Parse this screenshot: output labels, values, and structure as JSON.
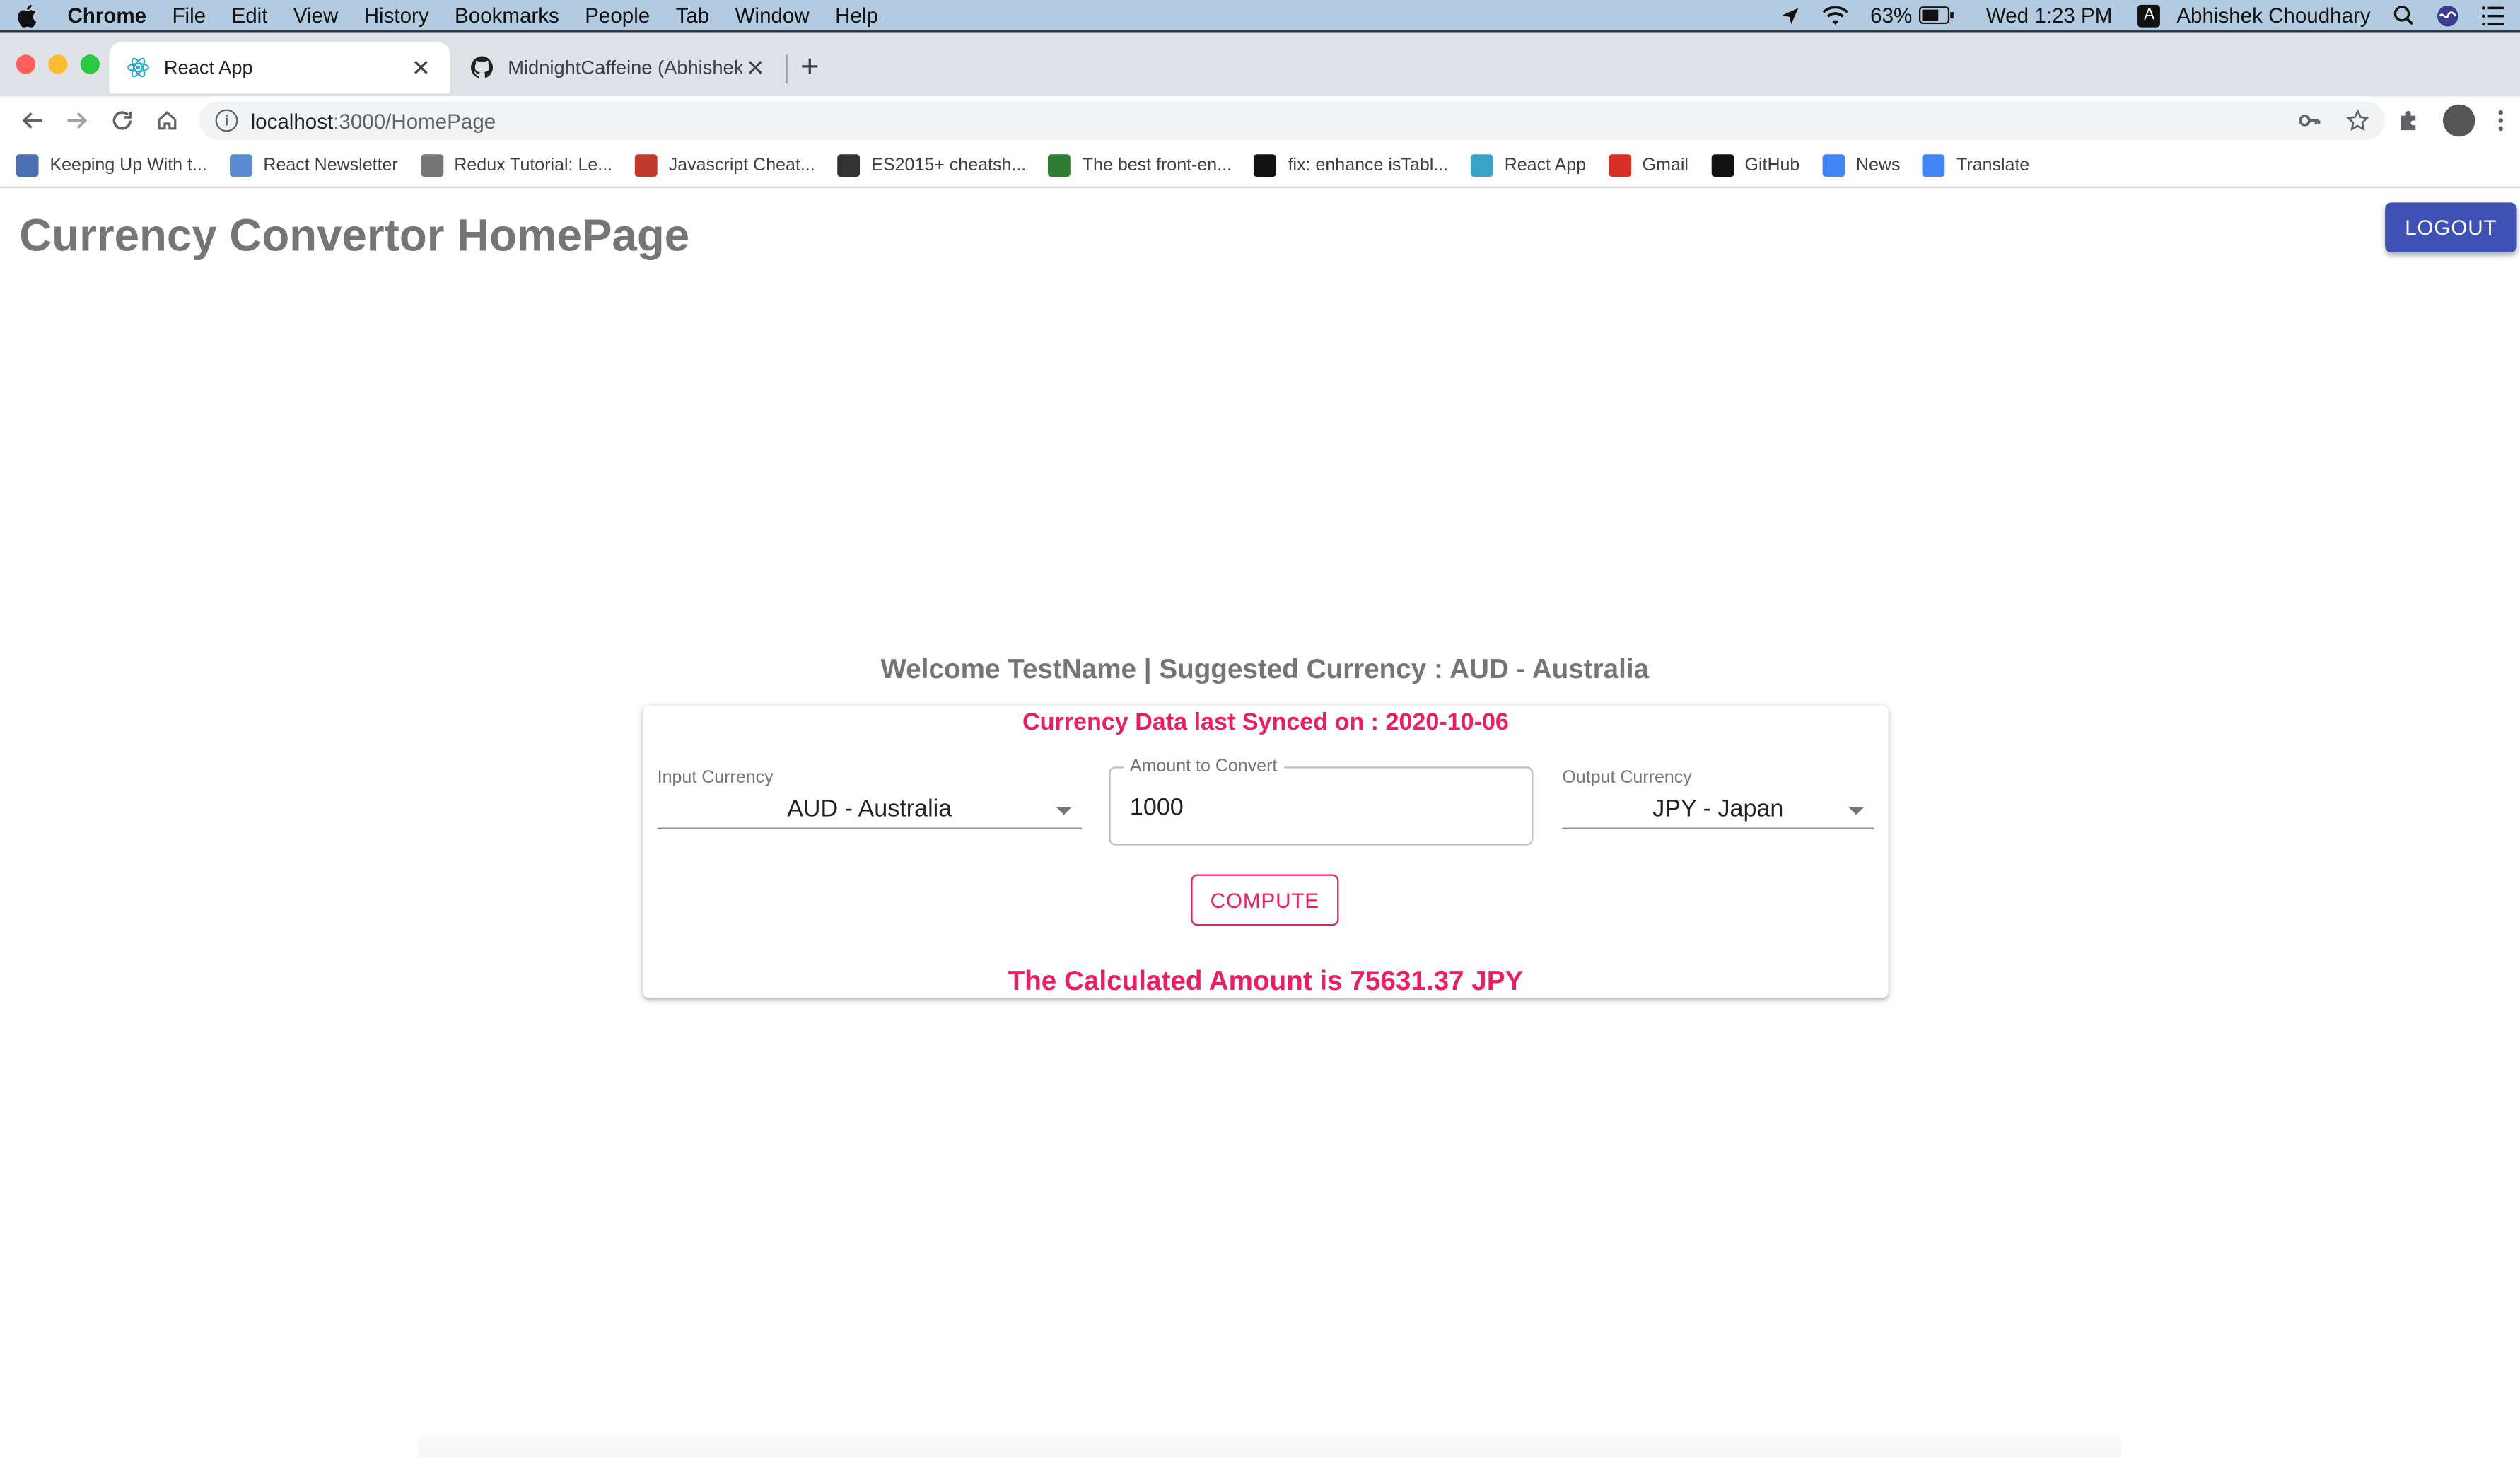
{
  "menubar": {
    "app": "Chrome",
    "menus": [
      "File",
      "Edit",
      "View",
      "History",
      "Bookmarks",
      "People",
      "Tab",
      "Window",
      "Help"
    ],
    "battery": "63%",
    "clock": "Wed 1:23 PM",
    "user": "Abhishek Choudhary",
    "input_badge": "A"
  },
  "tabs": [
    {
      "title": "React App",
      "close": "✕"
    },
    {
      "title": "MidnightCaffeine (Abhishek Ch",
      "close": "✕"
    }
  ],
  "new_tab": "+",
  "omnibox": {
    "host": "localhost",
    "path": ":3000/HomePage"
  },
  "bookmarks": [
    {
      "label": "Keeping Up With t...",
      "icon": "dc-icon",
      "color": "#4a6fb5"
    },
    {
      "label": "React Newsletter",
      "icon": "react-newsletter-icon",
      "color": "#5b8bd0"
    },
    {
      "label": "Redux Tutorial: Le...",
      "icon": "glasses-icon",
      "color": "#777777"
    },
    {
      "label": "Javascript Cheat...",
      "icon": "books-icon",
      "color": "#c0392b"
    },
    {
      "label": "ES2015+ cheatsh...",
      "icon": "globe-icon",
      "color": "#333333"
    },
    {
      "label": "The best front-en...",
      "icon": "frontend-icon",
      "color": "#2e7d32"
    },
    {
      "label": "fix: enhance isTabl...",
      "icon": "github-icon",
      "color": "#111111"
    },
    {
      "label": "React App",
      "icon": "react-icon",
      "color": "#3aa3c9"
    },
    {
      "label": "Gmail",
      "icon": "gmail-icon",
      "color": "#d93025"
    },
    {
      "label": "GitHub",
      "icon": "github-icon",
      "color": "#111111"
    },
    {
      "label": "News",
      "icon": "news-icon",
      "color": "#4285f4"
    },
    {
      "label": "Translate",
      "icon": "translate-icon",
      "color": "#4285f4"
    }
  ],
  "page": {
    "title": "Currency Convertor HomePage",
    "logout_label": "LOGOUT",
    "welcome": "Welcome TestName | Suggested Currency : AUD - Australia",
    "sync": "Currency Data last Synced on : 2020-10-06",
    "input_currency_label": "Input Currency",
    "input_currency_value": "AUD - Australia",
    "amount_label": "Amount to Convert",
    "amount_value": "1000",
    "output_currency_label": "Output Currency",
    "output_currency_value": "JPY - Japan",
    "compute_label": "COMPUTE",
    "result": "The Calculated Amount is 75631.37 JPY"
  },
  "colors": {
    "accent_pink": "#e91e63",
    "logout_blue": "#3f51b5",
    "title_gray": "#757575"
  }
}
